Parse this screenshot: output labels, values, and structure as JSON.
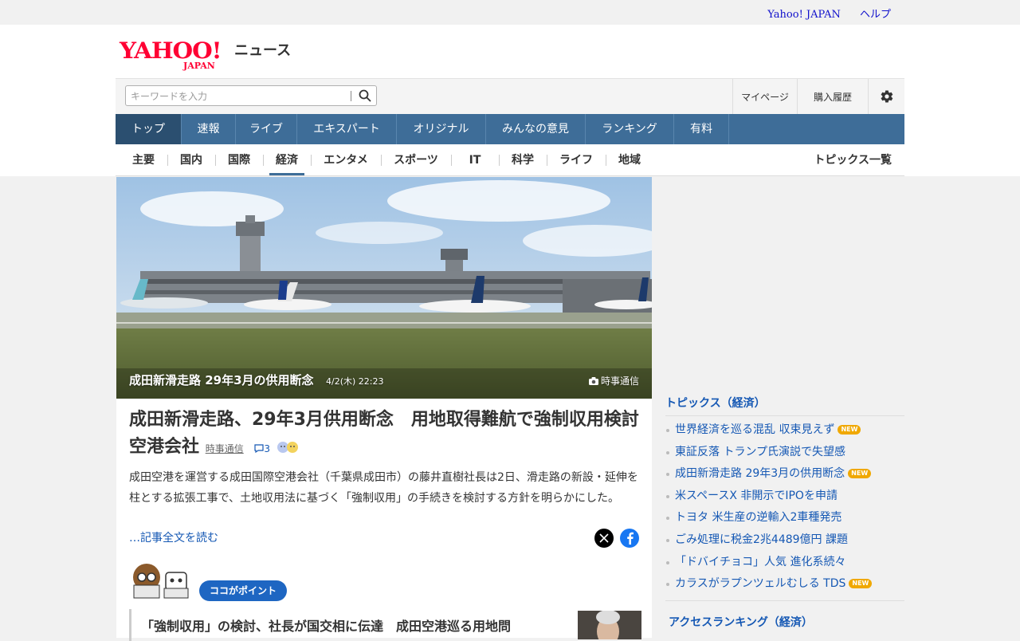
{
  "top_links": {
    "yahoo_japan": "Yahoo! JAPAN",
    "help": "ヘルプ"
  },
  "logo": {
    "yahoo": "YAHOO!",
    "japan": "JAPAN",
    "service": "ニュース"
  },
  "search": {
    "placeholder": "キーワードを入力",
    "value": ""
  },
  "header_buttons": {
    "mypage": "マイページ",
    "history": "購入履歴"
  },
  "main_nav": [
    "トップ",
    "速報",
    "ライブ",
    "エキスパート",
    "オリジナル",
    "みんなの意見",
    "ランキング",
    "有料"
  ],
  "sub_nav": [
    "主要",
    "国内",
    "国際",
    "経済",
    "エンタメ",
    "スポーツ",
    "IT",
    "科学",
    "ライフ",
    "地域"
  ],
  "sub_nav_active": "経済",
  "sub_nav_all": "トピックス一覧",
  "hero": {
    "caption": "成田新滑走路 29年3月の供用断念",
    "date": "4/2(木) 22:23",
    "source": "時事通信"
  },
  "article": {
    "headline": "成田新滑走路、29年3月供用断念　用地取得難航で強制収用検討　空港会社",
    "source": "時事通信",
    "comments": "3",
    "summary": "成田空港を運営する成田国際空港会社（千葉県成田市）の藤井直樹社長は2日、滑走路の新設・延伸を柱とする拡張工事で、土地収用法に基づく「強制収用」の手続きを検討する方針を明らかにした。",
    "read_more": "…記事全文を読む",
    "point_badge": "ココがポイント",
    "related_title": "「強制収用」の検討、社長が国交相に伝達　成田空港巡る用地問"
  },
  "sidebar": {
    "topics_title": "トピックス（経済）",
    "topics": [
      {
        "text": "世界経済を巡る混乱 収束見えず",
        "new": "NEW"
      },
      {
        "text": "東証反落 トランプ氏演説で失望感",
        "new": ""
      },
      {
        "text": "成田新滑走路 29年3月の供用断念",
        "new": "NEW"
      },
      {
        "text": "米スペースX 非開示でIPOを申請",
        "new": ""
      },
      {
        "text": "トヨタ 米生産の逆輸入2車種発売",
        "new": ""
      },
      {
        "text": "ごみ処理に税金2兆4489億円 課題",
        "new": ""
      },
      {
        "text": "「ドバイチョコ」人気 進化系続々",
        "new": ""
      },
      {
        "text": "カラスがラプンツェルむしる TDS",
        "new": "NEW"
      }
    ],
    "ranking_title": "アクセスランキング（経済）"
  },
  "colors": {
    "nav_blue": "#3e6d98",
    "link_blue": "#1558b4",
    "yahoo_red": "#ff0033",
    "new_badge": "#f0a800"
  }
}
